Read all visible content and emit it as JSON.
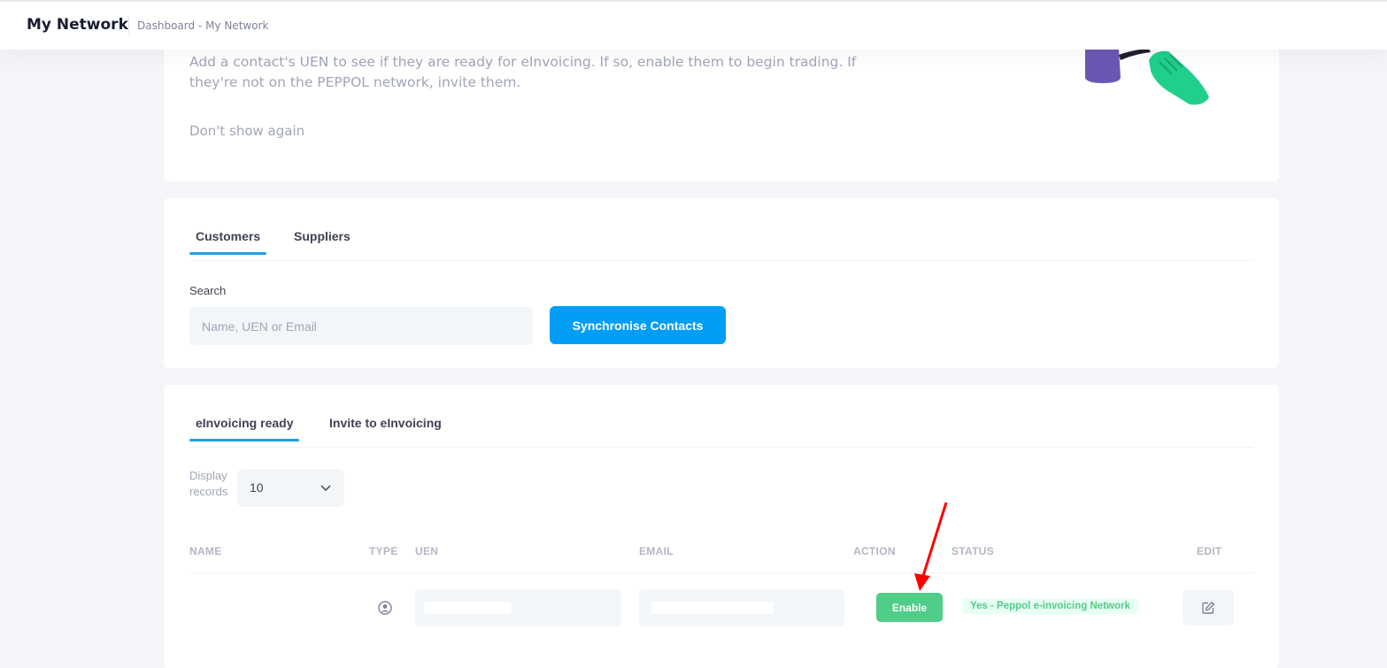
{
  "header": {
    "title": "My Network",
    "breadcrumb": "Dashboard - My Network"
  },
  "intro": {
    "text": "Add a contact's UEN to see if they are ready for eInvoicing. If so, enable them to begin trading. If they're not on the PEPPOL network, invite them.",
    "dont_show": "Don't show again"
  },
  "contact_tabs": [
    {
      "label": "Customers",
      "active": true
    },
    {
      "label": "Suppliers",
      "active": false
    }
  ],
  "search": {
    "label": "Search",
    "placeholder": "Name, UEN or Email",
    "sync_button": "Synchronise Contacts"
  },
  "list_tabs": [
    {
      "label": "eInvoicing ready",
      "active": true
    },
    {
      "label": "Invite to eInvoicing",
      "active": false
    }
  ],
  "display": {
    "label": "Display records",
    "value": "10"
  },
  "table": {
    "columns": [
      "NAME",
      "TYPE",
      "UEN",
      "EMAIL",
      "ACTION",
      "STATUS",
      "EDIT"
    ],
    "rows": [
      {
        "action_label": "Enable",
        "status": "Yes - Peppol e-invoicing Network"
      }
    ]
  },
  "colors": {
    "primary": "#009ef7",
    "success": "#50cd89",
    "tab_underline": "#1fa0e6",
    "annotation_arrow": "#ff0000"
  },
  "icons": {
    "type": "user-circle-icon",
    "edit": "edit-icon",
    "select": "chevron-down-icon"
  }
}
